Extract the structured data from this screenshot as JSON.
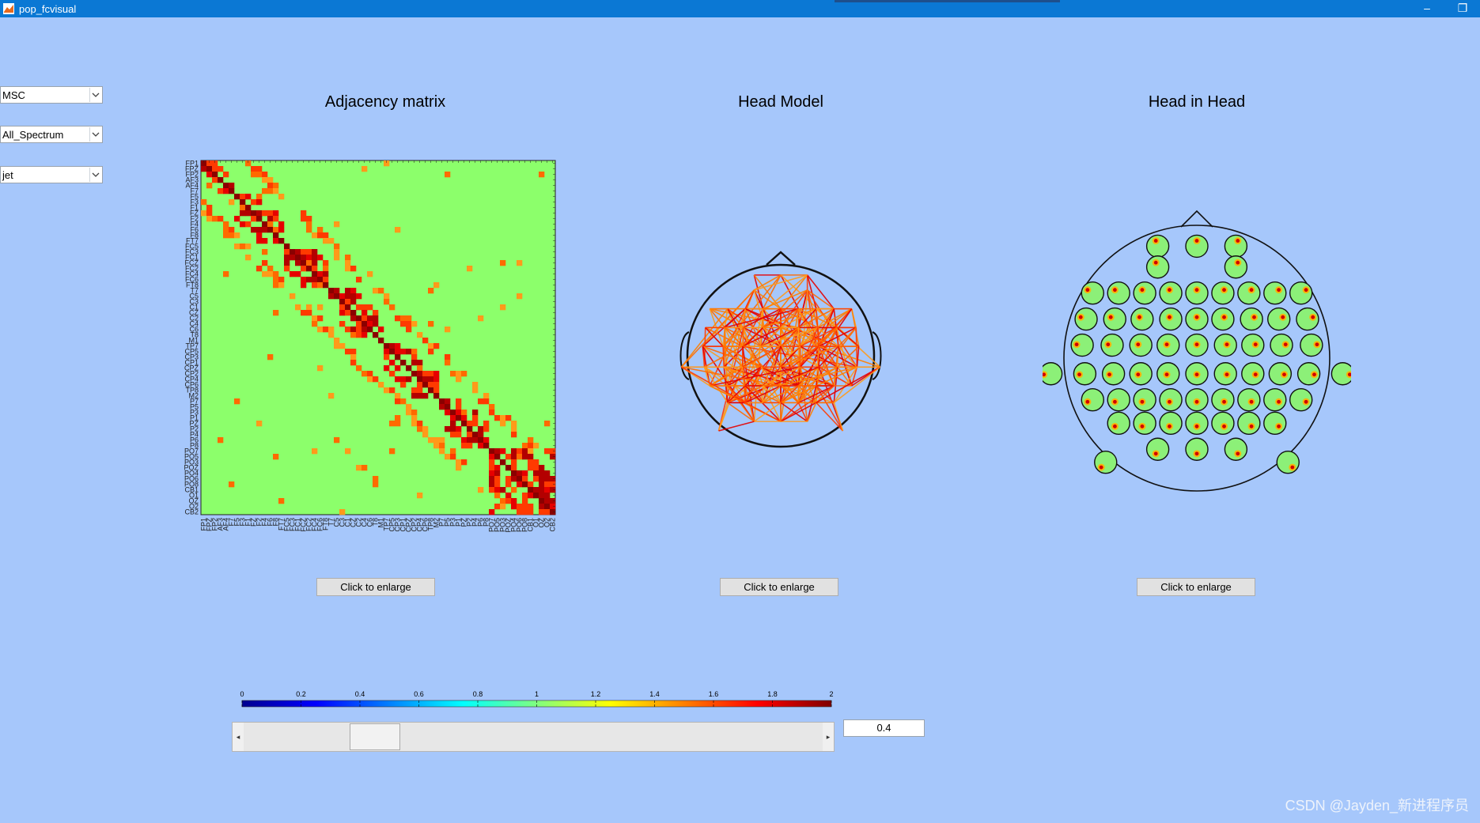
{
  "window": {
    "title": "pop_fcvisual",
    "minimize_glyph": "–",
    "restore_glyph": "❐",
    "bar_color": "#0b78d4"
  },
  "controls": {
    "measure": {
      "value": "MSC"
    },
    "band": {
      "value": "All_Spectrum"
    },
    "colormap": {
      "value": "jet"
    }
  },
  "panels": {
    "adjacency": {
      "title": "Adjacency matrix",
      "button": "Click to enlarge"
    },
    "head_model": {
      "title": "Head Model",
      "button": "Click to enlarge"
    },
    "head_in_head": {
      "title": "Head in Head",
      "button": "Click to enlarge"
    }
  },
  "channels": [
    "FP1",
    "FPZ",
    "FP2",
    "AF3",
    "AF4",
    "F7",
    "F5",
    "F3",
    "F1",
    "FZ",
    "F2",
    "F4",
    "F6",
    "F8",
    "FT7",
    "FC5",
    "FC3",
    "FC1",
    "FCZ",
    "FC2",
    "FC4",
    "FC6",
    "FT8",
    "T7",
    "C5",
    "C3",
    "C1",
    "CZ",
    "C2",
    "C4",
    "C6",
    "T8",
    "M1",
    "TP7",
    "CP5",
    "CP3",
    "CP1",
    "CPZ",
    "CP2",
    "CP4",
    "CP6",
    "TP8",
    "M2",
    "P7",
    "P5",
    "P3",
    "P1",
    "PZ",
    "P2",
    "P4",
    "P6",
    "P8",
    "PO7",
    "PO5",
    "PO3",
    "POZ",
    "PO4",
    "PO6",
    "PO8",
    "CB1",
    "O1",
    "OZ",
    "O2",
    "CB2"
  ],
  "colorbar": {
    "ticks": [
      "0",
      "0.2",
      "0.4",
      "0.6",
      "0.8",
      "1",
      "1.2",
      "1.4",
      "1.6",
      "1.8",
      "2"
    ],
    "min": 0,
    "max": 2,
    "colormap": "jet"
  },
  "slider": {
    "value": 0.4,
    "min": 0,
    "max": 2,
    "display": "0.4"
  },
  "watermark": "CSDN @Jayden_新进程序员",
  "colors": {
    "background": "#a6c7fb",
    "matrix_base": "#8cff6b",
    "head_base": "#8cf078"
  }
}
